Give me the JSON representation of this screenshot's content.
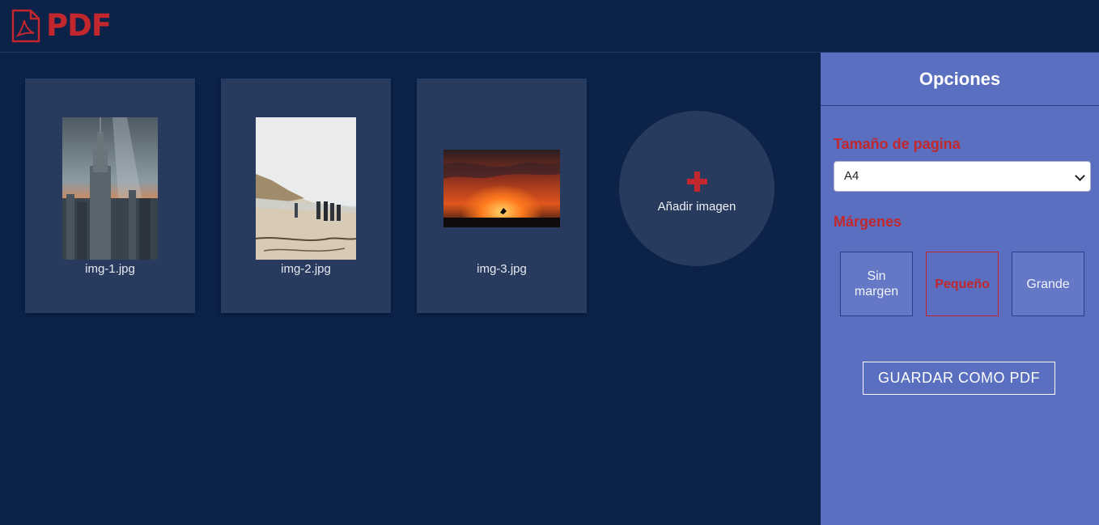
{
  "header": {
    "logo_text": "PDF",
    "logo_icon": "pdf-file-icon",
    "brand_color": "#c1272d"
  },
  "images": [
    {
      "filename": "img-1.jpg",
      "subject": "city skyscraper at sunset"
    },
    {
      "filename": "img-2.jpg",
      "subject": "people walking on beach"
    },
    {
      "filename": "img-3.jpg",
      "subject": "silhouette against orange sunset"
    }
  ],
  "add_image": {
    "label": "Añadir imagen",
    "icon": "plus-icon"
  },
  "options": {
    "title": "Opciones",
    "page_size_label": "Tamaño de pagina",
    "page_size_value": "A4",
    "margins_label": "Márgenes",
    "margins": [
      {
        "label": "Sin margen",
        "active": false
      },
      {
        "label": "Pequeño",
        "active": true
      },
      {
        "label": "Grande",
        "active": false
      }
    ],
    "save_label": "GUARDAR COMO PDF"
  },
  "colors": {
    "background": "#0c2249",
    "card": "#283b5e",
    "panel": "#5a6fbf",
    "accent": "#c1272d"
  }
}
